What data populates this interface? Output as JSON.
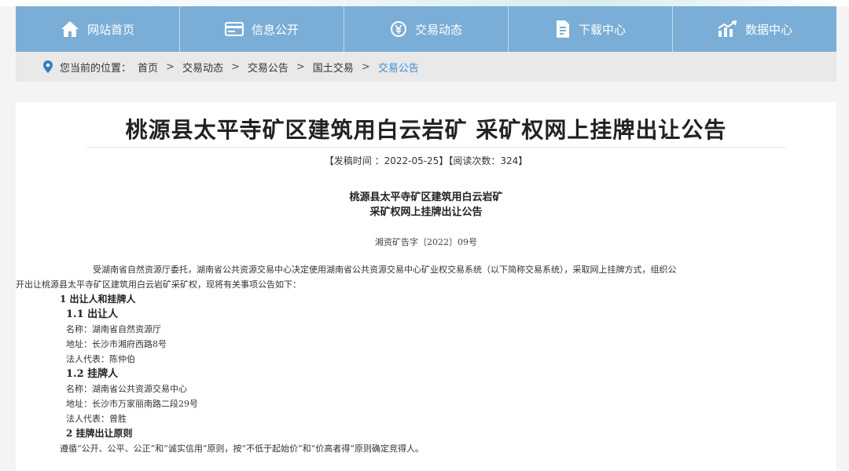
{
  "nav": {
    "items": [
      {
        "label": "网站首页",
        "icon": "home-icon"
      },
      {
        "label": "信息公开",
        "icon": "card-icon"
      },
      {
        "label": "交易动态",
        "icon": "yen-icon"
      },
      {
        "label": "下载中心",
        "icon": "download-doc-icon"
      },
      {
        "label": "数据中心",
        "icon": "chart-icon"
      }
    ]
  },
  "breadcrumb": {
    "label": "您当前的位置：",
    "items": [
      "首页",
      "交易动态",
      "交易公告",
      "国土交易",
      "交易公告"
    ],
    "sep": ">"
  },
  "article": {
    "title": "桃源县太平寺矿区建筑用白云岩矿 采矿权网上挂牌出让公告",
    "meta": "【发稿时间 ：2022-05-25】【阅读次数：324】",
    "subtitle1": "桃源县太平寺矿区建筑用白云岩矿",
    "subtitle2": "采矿权网上挂牌出让公告",
    "doc_no": "湘资矿告字〔2022〕09号",
    "para1a": "受湖南省自然资源厅委托，湖南省公共资源交易中心决定使用湖南省公共资源交易中心矿业权交易系统（以下简称交易系统），采取网上挂牌方式，组织公",
    "para1b": "开出让桃源县太平寺矿区建筑用白云岩矿采矿权，现将有关事项公告如下：",
    "sec1": "1 出让人和挂牌人",
    "sec1_1": "1.1 出让人",
    "seller_name": "名称：湖南省自然资源厅",
    "seller_addr": "地址：长沙市湘府西路8号",
    "seller_rep": "法人代表：陈仲伯",
    "sec1_2": "1.2 挂牌人",
    "lister_name": "名称：湖南省公共资源交易中心",
    "lister_addr": "地址：长沙市万家丽南路二段29号",
    "lister_rep": "法人代表：曾胜",
    "sec2": "2 挂牌出让原则",
    "principle": "遵循“公开、公平、公正”和“诚实信用”原则，按“不低于起始价”和“价高者得”原则确定竞得人。"
  }
}
